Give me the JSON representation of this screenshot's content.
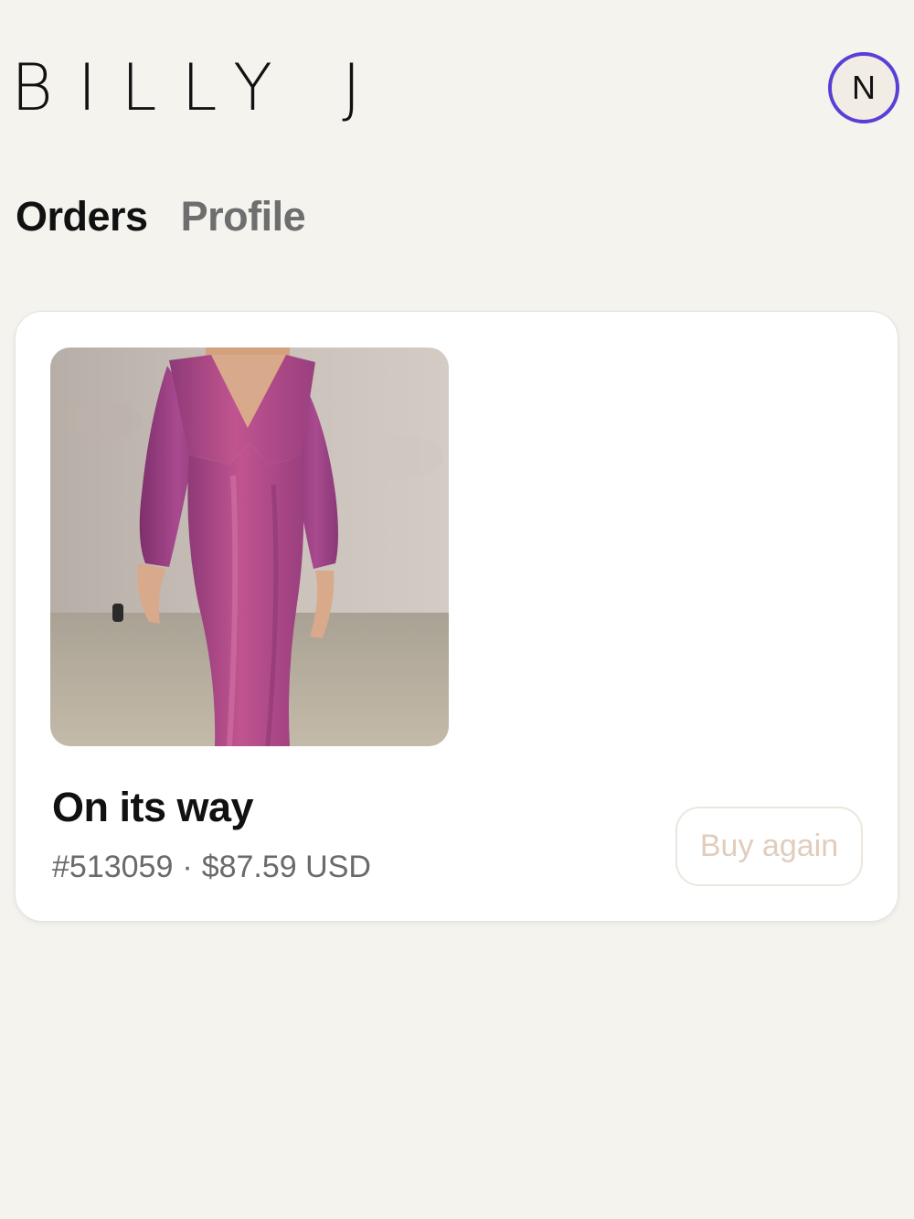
{
  "header": {
    "logo_text": "BILLY J",
    "avatar_initial": "N",
    "avatar_ring_color": "#5a3fd6"
  },
  "tabs": [
    {
      "label": "Orders",
      "active": true
    },
    {
      "label": "Profile",
      "active": false
    }
  ],
  "order": {
    "image_icon": "product-photo-pink-satin-dress",
    "status": "On its way",
    "number": "#513059",
    "separator": "·",
    "total": "$87.59 USD",
    "buy_again_label": "Buy again"
  },
  "colors": {
    "background": "#f4f3ee",
    "card": "#ffffff",
    "dress": "#b24b8c",
    "buy_again_text": "#e0cdbd"
  }
}
